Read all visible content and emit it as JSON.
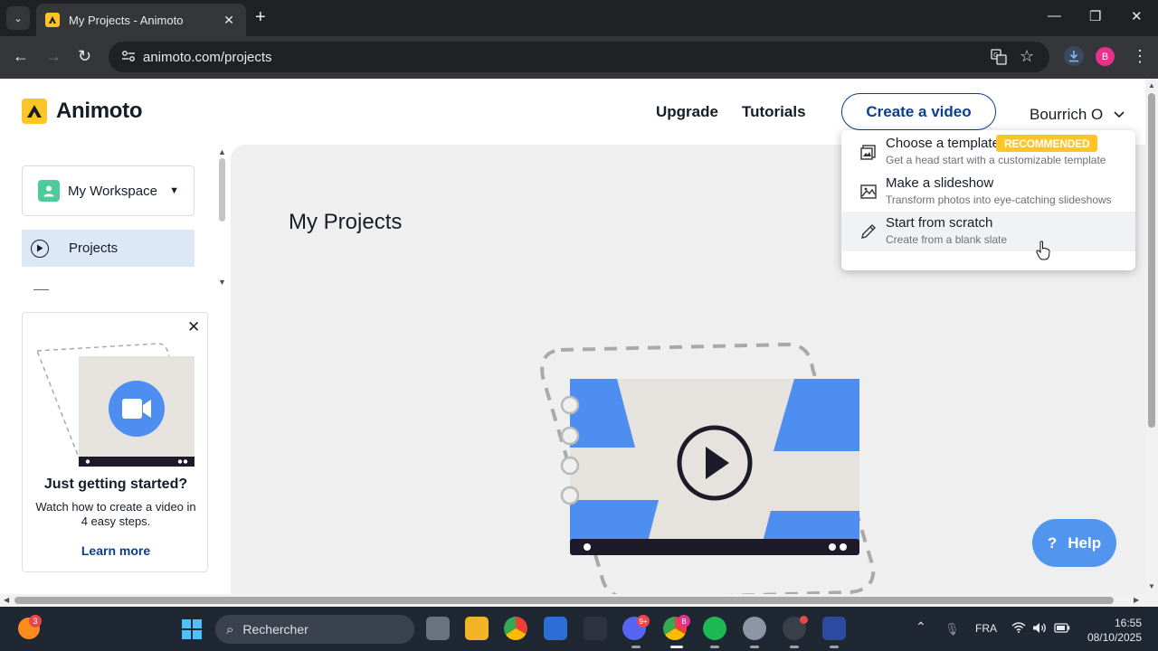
{
  "browser": {
    "tab_title": "My Projects - Animoto",
    "tab_close": "✕",
    "new_tab": "+",
    "url": "animoto.com/projects",
    "profile_initial": "B"
  },
  "header": {
    "brand": "Animoto",
    "nav": {
      "upgrade": "Upgrade",
      "tutorials": "Tutorials"
    },
    "create_button": "Create a video",
    "user_name": "Bourrich O"
  },
  "sidebar": {
    "workspace": "My Workspace",
    "projects": "Projects",
    "promo": {
      "title": "Just getting started?",
      "description": "Watch how to create a video in 4 easy steps.",
      "link": "Learn more"
    }
  },
  "main": {
    "title": "My Projects",
    "help_label": "Help",
    "help_icon": "?"
  },
  "dropdown": {
    "items": [
      {
        "title": "Choose a template",
        "subtitle": "Get a head start with a customizable template",
        "badge": "RECOMMENDED",
        "icon": "template-icon"
      },
      {
        "title": "Make a slideshow",
        "subtitle": "Transform photos into eye-catching slideshows",
        "icon": "image-icon"
      },
      {
        "title": "Start from scratch",
        "subtitle": "Create from a blank slate",
        "icon": "pencil-icon"
      }
    ]
  },
  "taskbar": {
    "weather_badge": "3",
    "search_placeholder": "Rechercher",
    "discord_badge": "9+",
    "chrome_badge": "B",
    "language": "FRA",
    "time": "16:55",
    "date": "08/10/2025"
  },
  "colors": {
    "brand_yellow": "#ffc526",
    "primary_blue": "#0b3e8f",
    "help_blue": "#5195ee",
    "hero_blue": "#4e8ef0"
  }
}
